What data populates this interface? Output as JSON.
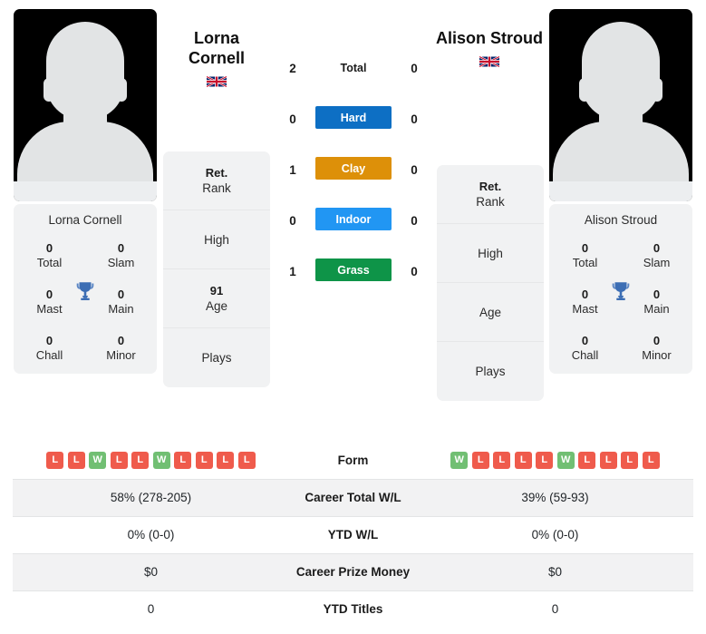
{
  "players": {
    "left": {
      "name": "Lorna Cornell",
      "name_line1": "Lorna",
      "name_line2": "Cornell",
      "flag": "gb-flag-icon",
      "titles": {
        "total": "0",
        "total_label": "Total",
        "slam": "0",
        "slam_label": "Slam",
        "mast": "0",
        "mast_label": "Mast",
        "main": "0",
        "main_label": "Main",
        "chall": "0",
        "chall_label": "Chall",
        "minor": "0",
        "minor_label": "Minor"
      },
      "info": {
        "rank_value": "Ret.",
        "rank_label": "Rank",
        "high_value": "",
        "high_label": "High",
        "age_value": "91",
        "age_label": "Age",
        "plays_value": "",
        "plays_label": "Plays"
      },
      "surfaces": {
        "total": "2",
        "hard": "0",
        "clay": "1",
        "indoor": "0",
        "grass": "1"
      },
      "form": [
        "L",
        "L",
        "W",
        "L",
        "L",
        "W",
        "L",
        "L",
        "L",
        "L"
      ],
      "stats": {
        "career_total_wl": "58% (278-205)",
        "ytd_wl": "0% (0-0)",
        "career_prize_money": "$0",
        "ytd_titles": "0"
      }
    },
    "right": {
      "name": "Alison Stroud",
      "name_line1": "Alison Stroud",
      "name_line2": "",
      "flag": "gb-flag-icon",
      "titles": {
        "total": "0",
        "total_label": "Total",
        "slam": "0",
        "slam_label": "Slam",
        "mast": "0",
        "mast_label": "Mast",
        "main": "0",
        "main_label": "Main",
        "chall": "0",
        "chall_label": "Chall",
        "minor": "0",
        "minor_label": "Minor"
      },
      "info": {
        "rank_value": "Ret.",
        "rank_label": "Rank",
        "high_value": "",
        "high_label": "High",
        "age_value": "",
        "age_label": "Age",
        "plays_value": "",
        "plays_label": "Plays"
      },
      "surfaces": {
        "total": "0",
        "hard": "0",
        "clay": "0",
        "indoor": "0",
        "grass": "0"
      },
      "form": [
        "W",
        "L",
        "L",
        "L",
        "L",
        "W",
        "L",
        "L",
        "L",
        "L"
      ],
      "stats": {
        "career_total_wl": "39% (59-93)",
        "ytd_wl": "0% (0-0)",
        "career_prize_money": "$0",
        "ytd_titles": "0"
      }
    }
  },
  "surface_labels": {
    "total": "Total",
    "hard": "Hard",
    "clay": "Clay",
    "indoor": "Indoor",
    "grass": "Grass"
  },
  "surface_colors": {
    "hard": "#0d6fc4",
    "clay": "#dd9009",
    "indoor": "#2196f3",
    "grass": "#0e9448"
  },
  "table_labels": {
    "form": "Form",
    "career_total_wl": "Career Total W/L",
    "ytd_wl": "YTD W/L",
    "career_prize_money": "Career Prize Money",
    "ytd_titles": "YTD Titles"
  },
  "form_colors": {
    "win": "#71bf73",
    "loss": "#ef5b4c"
  },
  "icons": {
    "trophy": "trophy-icon"
  }
}
